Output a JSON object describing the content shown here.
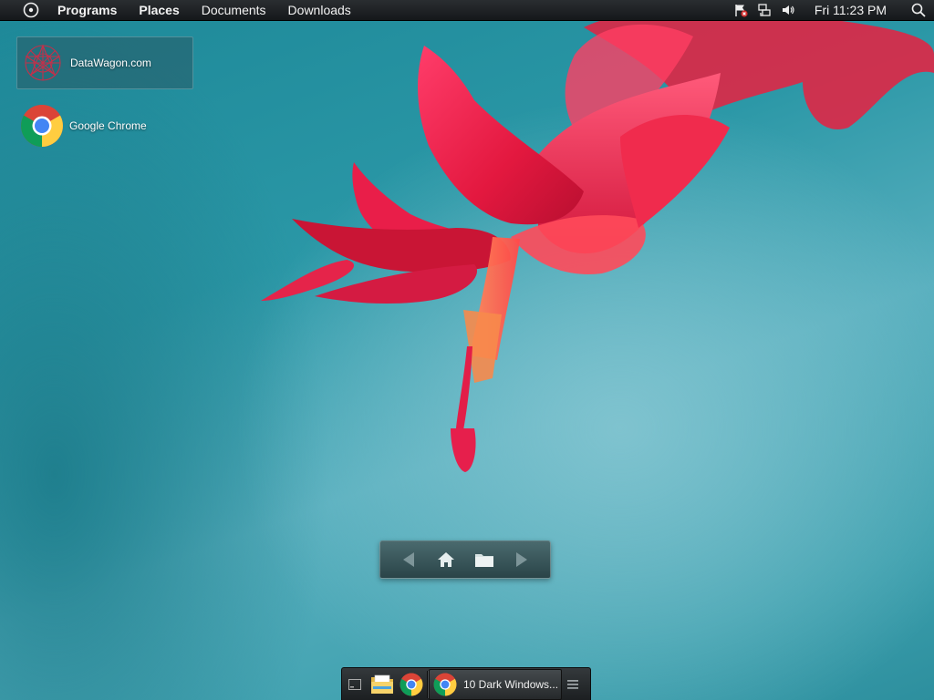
{
  "top_panel": {
    "menu": [
      "Programs",
      "Places",
      "Documents",
      "Downloads"
    ],
    "clock": "Fri 11:23 PM"
  },
  "desktop_icons": [
    {
      "label": "DataWagon.com",
      "icon": "datawagon-icon",
      "selected": true
    },
    {
      "label": "Google Chrome",
      "icon": "chrome-icon",
      "selected": false
    }
  ],
  "nav_widget": {
    "buttons": [
      "back-arrow-icon",
      "home-icon",
      "folder-icon",
      "forward-arrow-icon"
    ]
  },
  "taskbar": {
    "launchers": [
      "show-desktop-icon",
      "file-explorer-icon",
      "chrome-icon"
    ],
    "tasks": [
      {
        "label": "10 Dark Windows...",
        "icon": "chrome-icon"
      }
    ],
    "menu_icon": "hamburger-icon"
  },
  "colors": {
    "panel": "#1d2123",
    "wallpaper_teal": "#2a97a6",
    "flower_red": "#e8264a"
  }
}
